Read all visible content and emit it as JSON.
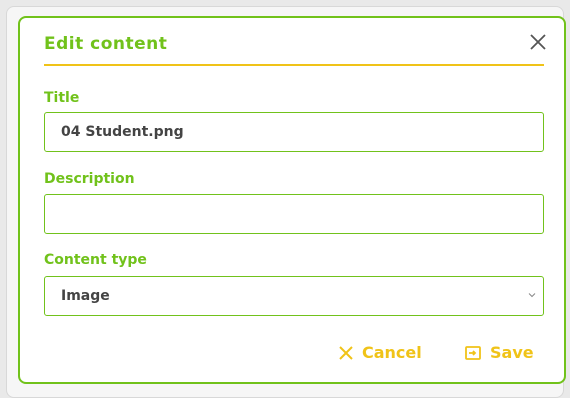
{
  "dialog": {
    "title": "Edit content",
    "close_icon": "close-icon"
  },
  "form": {
    "title_label": "Title",
    "title_value": "04 Student.png",
    "description_label": "Description",
    "description_value": "",
    "content_type_label": "Content type",
    "content_type_value": "Image"
  },
  "footer": {
    "cancel_label": "Cancel",
    "save_label": "Save",
    "cancel_icon": "close-icon",
    "save_icon": "save-icon"
  },
  "colors": {
    "accent_green": "#71c21b",
    "accent_yellow": "#f0c318"
  }
}
